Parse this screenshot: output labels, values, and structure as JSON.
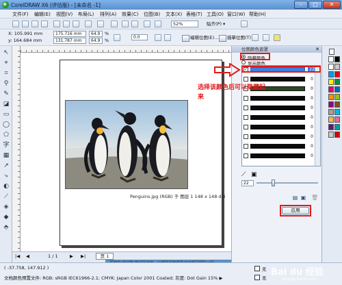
{
  "window": {
    "title": "CorelDRAW X6 (评估版) - [未命名 -1]",
    "min": "–",
    "max": "□",
    "close": "✕"
  },
  "menu": [
    "文件(F)",
    "编辑(E)",
    "视图(V)",
    "布局(L)",
    "排列(A)",
    "效果(C)",
    "位图(B)",
    "文本(X)",
    "表格(T)",
    "工具(O)",
    "窗口(W)",
    "帮助(H)"
  ],
  "toolbar": {
    "zoom": "52%",
    "snap": "贴齐(P) ▾"
  },
  "propbar": {
    "x": "X: 105.991 mm",
    "y": "y: 164.684 mm",
    "w": "175.716 mm",
    "h": "131.787 mm",
    "sx": "64.9",
    "sy": "64.9",
    "pct": "%",
    "angle": "0.0",
    "edit_bitmap": "编辑位图(E)...",
    "trace_bitmap": "描摹位图(T)"
  },
  "docker": {
    "title": "位图颜色遮罩",
    "close": "✕",
    "opt_hide": "隐藏颜色",
    "opt_show": "显示颜色",
    "rows": [
      {
        "checked": "✓",
        "value": "22",
        "color": "#3f7fe0",
        "selected": true
      },
      {
        "checked": "",
        "value": "0",
        "color": "#0a0a0a"
      },
      {
        "checked": "",
        "value": "0",
        "color": "#2d4a1f"
      },
      {
        "checked": "",
        "value": "0",
        "color": "#0a0a0a"
      },
      {
        "checked": "",
        "value": "0",
        "color": "#0a0a0a"
      },
      {
        "checked": "",
        "value": "0",
        "color": "#0a0a0a"
      },
      {
        "checked": "",
        "value": "0",
        "color": "#0a0a0a"
      },
      {
        "checked": "",
        "value": "0",
        "color": "#0a0a0a"
      },
      {
        "checked": "",
        "value": "0",
        "color": "#0a0a0a"
      },
      {
        "checked": "",
        "value": "0",
        "color": "#0a0a0a"
      }
    ],
    "tolerance": "22",
    "apply": "应用"
  },
  "annotation": {
    "text": "选择该颜色后可以隐藏起来"
  },
  "canvas": {
    "caption": "Penguins.jpg (RGB) 于 图层 1 148 x 148 dpi",
    "page_label": "页 1",
    "page_count": "1 / 1",
    "hint": "将颜色(或对象)拖动至此处，以便将这些颜色与文档存储在一起"
  },
  "status": {
    "coords": "( -37.758, 147.912 )",
    "color_info": "文档颜色预置文件: RGB: sRGB IEC61966-2.1; CMYK: Japan Color 2001 Coated; 灰度: Dot Gain 15% ▶",
    "fill": "无",
    "outline": "无"
  },
  "watermark": {
    "brand": "Bai du 经验",
    "sub": "jingyan.baidu.com"
  },
  "palette_colors": [
    "#ffffff",
    "#000000",
    "#ffffff",
    "#c8c8c8",
    "#00a0e9",
    "#e60012",
    "#fff100",
    "#00913a",
    "#e4007f",
    "#0068b7",
    "#f39800",
    "#8fc31f",
    "#920783",
    "#7f4f21",
    "#a0a0a0",
    "#00b7ee",
    "#f8b551",
    "#ea68a2",
    "#601986",
    "#009e96",
    "#c9caca",
    "#d7000f"
  ]
}
